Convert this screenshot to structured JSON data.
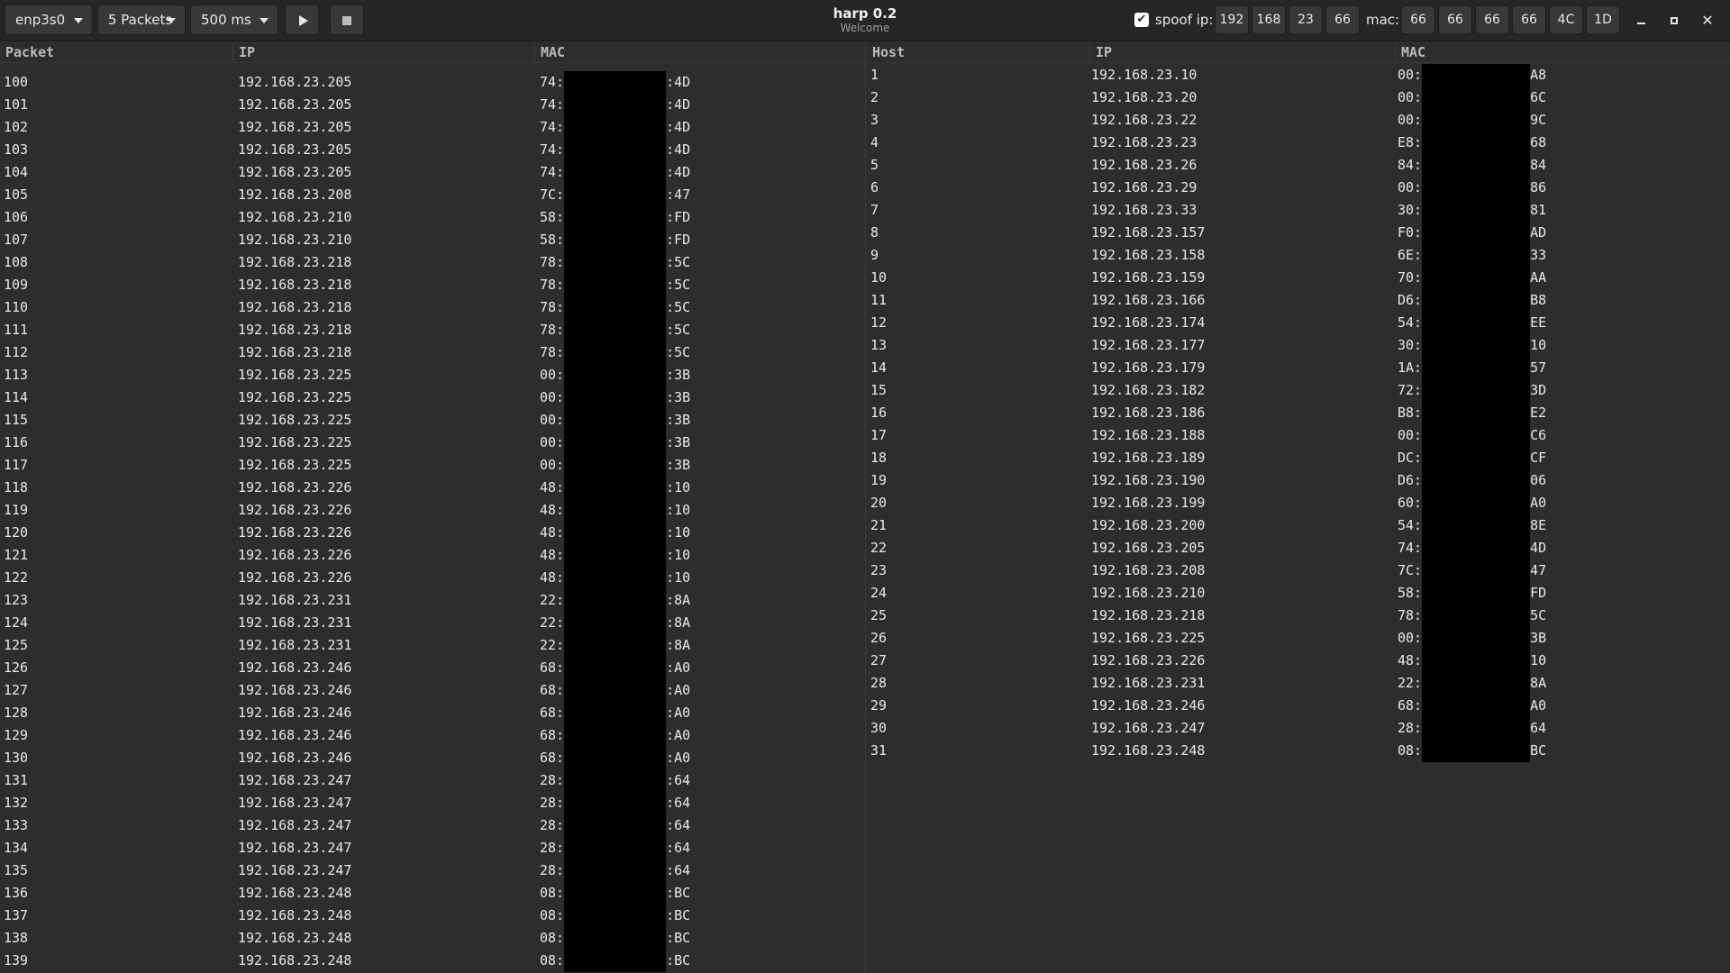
{
  "header": {
    "interface": "enp3s0",
    "packets": "5 Packets",
    "interval": "500 ms",
    "title": "harp 0.2",
    "subtitle": "Welcome",
    "spoof_checked": true,
    "spoof_label": "spoof ip:",
    "spoof_ip": [
      "192",
      "168",
      "23",
      "66"
    ],
    "mac_label": "mac:",
    "spoof_mac": [
      "66",
      "66",
      "66",
      "66",
      "4C",
      "1D"
    ],
    "checkmark_glyph": "✔",
    "close_glyph": "✕"
  },
  "packets_table": {
    "columns": [
      "Packet",
      "IP",
      "MAC"
    ],
    "rows": [
      [
        "100",
        "192.168.23.205",
        "74:",
        ":4D"
      ],
      [
        "101",
        "192.168.23.205",
        "74:",
        ":4D"
      ],
      [
        "102",
        "192.168.23.205",
        "74:",
        ":4D"
      ],
      [
        "103",
        "192.168.23.205",
        "74:",
        ":4D"
      ],
      [
        "104",
        "192.168.23.205",
        "74:",
        ":4D"
      ],
      [
        "105",
        "192.168.23.208",
        "7C:",
        ":47"
      ],
      [
        "106",
        "192.168.23.210",
        "58:",
        ":FD"
      ],
      [
        "107",
        "192.168.23.210",
        "58:",
        ":FD"
      ],
      [
        "108",
        "192.168.23.218",
        "78:",
        ":5C"
      ],
      [
        "109",
        "192.168.23.218",
        "78:",
        ":5C"
      ],
      [
        "110",
        "192.168.23.218",
        "78:",
        ":5C"
      ],
      [
        "111",
        "192.168.23.218",
        "78:",
        ":5C"
      ],
      [
        "112",
        "192.168.23.218",
        "78:",
        ":5C"
      ],
      [
        "113",
        "192.168.23.225",
        "00:",
        ":3B"
      ],
      [
        "114",
        "192.168.23.225",
        "00:",
        ":3B"
      ],
      [
        "115",
        "192.168.23.225",
        "00:",
        ":3B"
      ],
      [
        "116",
        "192.168.23.225",
        "00:",
        ":3B"
      ],
      [
        "117",
        "192.168.23.225",
        "00:",
        ":3B"
      ],
      [
        "118",
        "192.168.23.226",
        "48:",
        ":10"
      ],
      [
        "119",
        "192.168.23.226",
        "48:",
        ":10"
      ],
      [
        "120",
        "192.168.23.226",
        "48:",
        ":10"
      ],
      [
        "121",
        "192.168.23.226",
        "48:",
        ":10"
      ],
      [
        "122",
        "192.168.23.226",
        "48:",
        ":10"
      ],
      [
        "123",
        "192.168.23.231",
        "22:",
        ":8A"
      ],
      [
        "124",
        "192.168.23.231",
        "22:",
        ":8A"
      ],
      [
        "125",
        "192.168.23.231",
        "22:",
        ":8A"
      ],
      [
        "126",
        "192.168.23.246",
        "68:",
        ":A0"
      ],
      [
        "127",
        "192.168.23.246",
        "68:",
        ":A0"
      ],
      [
        "128",
        "192.168.23.246",
        "68:",
        ":A0"
      ],
      [
        "129",
        "192.168.23.246",
        "68:",
        ":A0"
      ],
      [
        "130",
        "192.168.23.246",
        "68:",
        ":A0"
      ],
      [
        "131",
        "192.168.23.247",
        "28:",
        ":64"
      ],
      [
        "132",
        "192.168.23.247",
        "28:",
        ":64"
      ],
      [
        "133",
        "192.168.23.247",
        "28:",
        ":64"
      ],
      [
        "134",
        "192.168.23.247",
        "28:",
        ":64"
      ],
      [
        "135",
        "192.168.23.247",
        "28:",
        ":64"
      ],
      [
        "136",
        "192.168.23.248",
        "08:",
        ":BC"
      ],
      [
        "137",
        "192.168.23.248",
        "08:",
        ":BC"
      ],
      [
        "138",
        "192.168.23.248",
        "08:",
        ":BC"
      ],
      [
        "139",
        "192.168.23.248",
        "08:",
        ":BC"
      ]
    ]
  },
  "hosts_table": {
    "columns": [
      "Host",
      "IP",
      "MAC"
    ],
    "rows": [
      [
        "1",
        "192.168.23.10",
        "00:",
        "A8"
      ],
      [
        "2",
        "192.168.23.20",
        "00:",
        "6C"
      ],
      [
        "3",
        "192.168.23.22",
        "00:",
        "9C"
      ],
      [
        "4",
        "192.168.23.23",
        "E8:",
        "68"
      ],
      [
        "5",
        "192.168.23.26",
        "84:",
        "84"
      ],
      [
        "6",
        "192.168.23.29",
        "00:",
        "86"
      ],
      [
        "7",
        "192.168.23.33",
        "30:",
        "81"
      ],
      [
        "8",
        "192.168.23.157",
        "F0:",
        "AD"
      ],
      [
        "9",
        "192.168.23.158",
        "6E:",
        "33"
      ],
      [
        "10",
        "192.168.23.159",
        "70:",
        "AA"
      ],
      [
        "11",
        "192.168.23.166",
        "D6:",
        "B8"
      ],
      [
        "12",
        "192.168.23.174",
        "54:",
        "EE"
      ],
      [
        "13",
        "192.168.23.177",
        "30:",
        "10"
      ],
      [
        "14",
        "192.168.23.179",
        "1A:",
        "57"
      ],
      [
        "15",
        "192.168.23.182",
        "72:",
        "3D"
      ],
      [
        "16",
        "192.168.23.186",
        "B8:",
        "E2"
      ],
      [
        "17",
        "192.168.23.188",
        "00:",
        "C6"
      ],
      [
        "18",
        "192.168.23.189",
        "DC:",
        "CF"
      ],
      [
        "19",
        "192.168.23.190",
        "D6:",
        "06"
      ],
      [
        "20",
        "192.168.23.199",
        "60:",
        "A0"
      ],
      [
        "21",
        "192.168.23.200",
        "54:",
        "8E"
      ],
      [
        "22",
        "192.168.23.205",
        "74:",
        "4D"
      ],
      [
        "23",
        "192.168.23.208",
        "7C:",
        "47"
      ],
      [
        "24",
        "192.168.23.210",
        "58:",
        "FD"
      ],
      [
        "25",
        "192.168.23.218",
        "78:",
        "5C"
      ],
      [
        "26",
        "192.168.23.225",
        "00:",
        "3B"
      ],
      [
        "27",
        "192.168.23.226",
        "48:",
        "10"
      ],
      [
        "28",
        "192.168.23.231",
        "22:",
        "8A"
      ],
      [
        "29",
        "192.168.23.246",
        "68:",
        "A0"
      ],
      [
        "30",
        "192.168.23.247",
        "28:",
        "64"
      ],
      [
        "31",
        "192.168.23.248",
        "08:",
        "BC"
      ]
    ]
  }
}
